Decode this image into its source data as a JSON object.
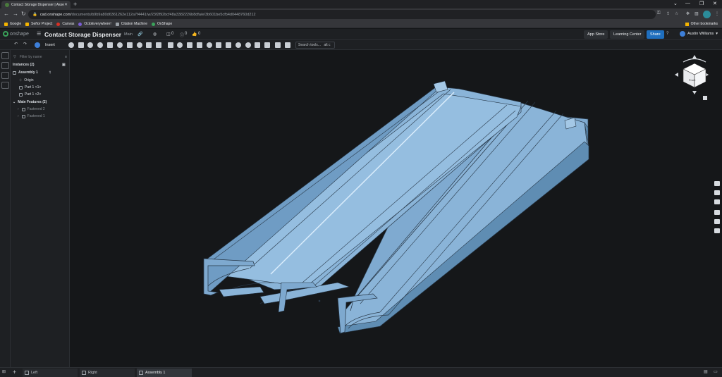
{
  "browser": {
    "tab_title": "Contact Storage Dispenser | Asse",
    "url_host": "cad.onshape.com",
    "url_path": "/documents/b9b9a80d6361262e112a7f4441/w/23f2f92bcf48a3382226b8dfa/e/3b601be5cfb4d0448760d212",
    "bookmarks": [
      {
        "label": "Google",
        "color": "#f4b400"
      },
      {
        "label": "Señor Project",
        "color": "#f4b400"
      },
      {
        "label": "Canvas",
        "color": "#d93025"
      },
      {
        "label": "OctoEverywhere!",
        "color": "#7b5cd6"
      },
      {
        "label": "Citation Machine",
        "color": "#9aa0a6"
      },
      {
        "label": "OnShape",
        "color": "#3aa35a"
      }
    ],
    "other_bookmarks": "Other bookmarks"
  },
  "header": {
    "logo_text": "onshape",
    "document_name": "Contact Storage Dispenser",
    "branch": "Main",
    "counts": [
      "0",
      "0",
      "0"
    ],
    "app_store": "App Store",
    "learning_center": "Learning Center",
    "share": "Share",
    "help": "?",
    "user_name": "Austin Williams"
  },
  "toolbar": {
    "insert_label": "Insert",
    "search_placeholder": "Search tools...",
    "search_shortcut": "alt c"
  },
  "panel": {
    "filter_placeholder": "Filter by name",
    "instances_header": "Instances (2)",
    "assembly": "Assembly 1",
    "origin": "Origin",
    "part1": "Part 1 <1>",
    "part2": "Part 1 <2>",
    "mate_header": "Mate Features (2)",
    "fastened2": "Fastened 2",
    "fastened1": "Fastened 1"
  },
  "tabs": [
    {
      "label": "Left"
    },
    {
      "label": "Right"
    },
    {
      "label": "Assembly 1"
    }
  ],
  "viewcube": {
    "face": "Front"
  },
  "colors": {
    "model": "#8ab4d8",
    "model_dark": "#5f8db3",
    "accent": "#1f6fbf"
  }
}
